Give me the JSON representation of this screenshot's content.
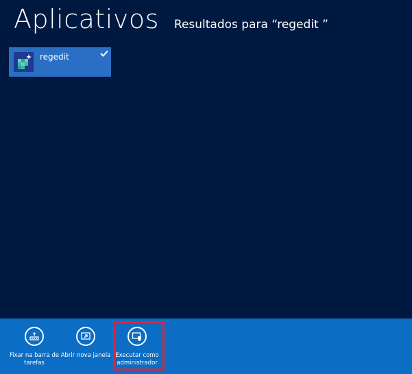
{
  "header": {
    "title": "Aplicativos",
    "subtitle": "Resultados para “regedit ”"
  },
  "results": [
    {
      "label": "regedit",
      "icon": "registry-editor-icon",
      "selected": true
    }
  ],
  "appbar": {
    "buttons": [
      {
        "label": "Fixar na barra de tarefas",
        "icon": "pin-taskbar-icon"
      },
      {
        "label": "Abrir nova janela",
        "icon": "new-window-icon"
      },
      {
        "label": "Executar como administrador",
        "icon": "run-as-admin-icon"
      }
    ]
  },
  "colors": {
    "background": "#001940",
    "tile": "#2a6fc4",
    "appbar": "#0b6dc4",
    "highlight": "#d9263e"
  }
}
